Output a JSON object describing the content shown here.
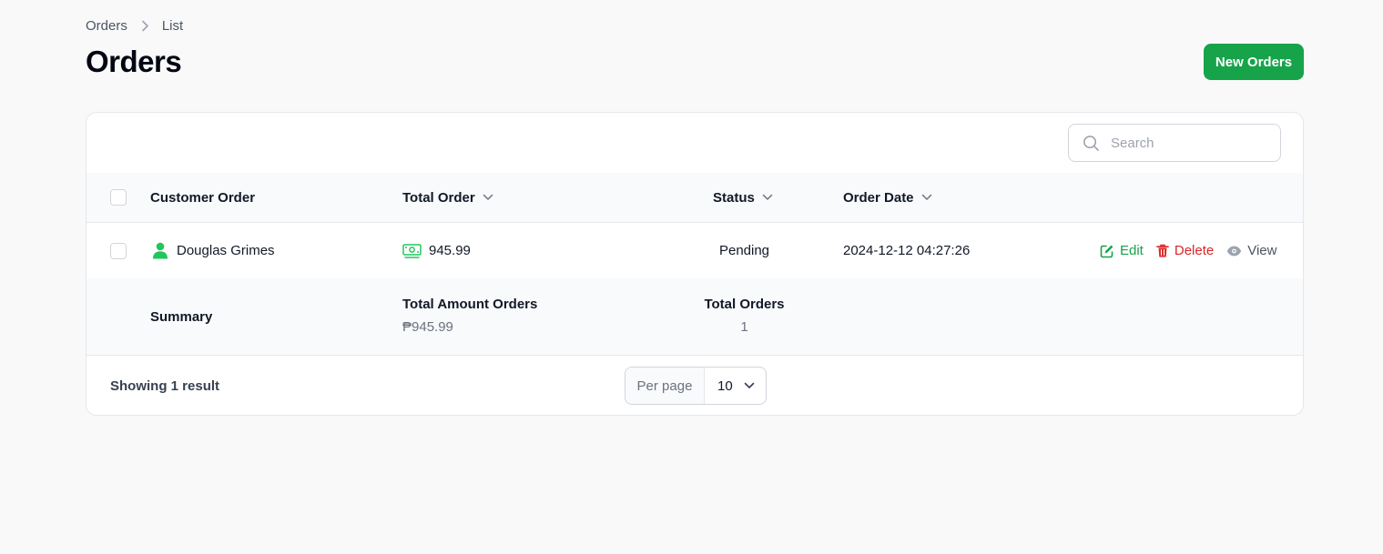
{
  "breadcrumb": {
    "items": [
      "Orders",
      "List"
    ]
  },
  "header": {
    "title": "Orders",
    "new_button_label": "New Orders"
  },
  "search": {
    "placeholder": "Search",
    "value": ""
  },
  "table": {
    "columns": {
      "customer": "Customer Order",
      "total": "Total Order",
      "status": "Status",
      "date": "Order Date"
    },
    "rows": [
      {
        "customer": "Douglas Grimes",
        "total": "945.99",
        "status": "Pending",
        "date": "2024-12-12 04:27:26",
        "actions": {
          "edit": "Edit",
          "delete": "Delete",
          "view": "View"
        }
      }
    ],
    "summary": {
      "label": "Summary",
      "amount_header": "Total Amount Orders",
      "amount_value": "₱945.99",
      "count_header": "Total Orders",
      "count_value": "1"
    }
  },
  "footer": {
    "showing": "Showing 1 result",
    "per_page_label": "Per page",
    "per_page_value": "10"
  },
  "colors": {
    "primary": "#16a34a",
    "danger": "#dc2626",
    "muted": "#6b7280",
    "icon_green": "#22c55e"
  }
}
